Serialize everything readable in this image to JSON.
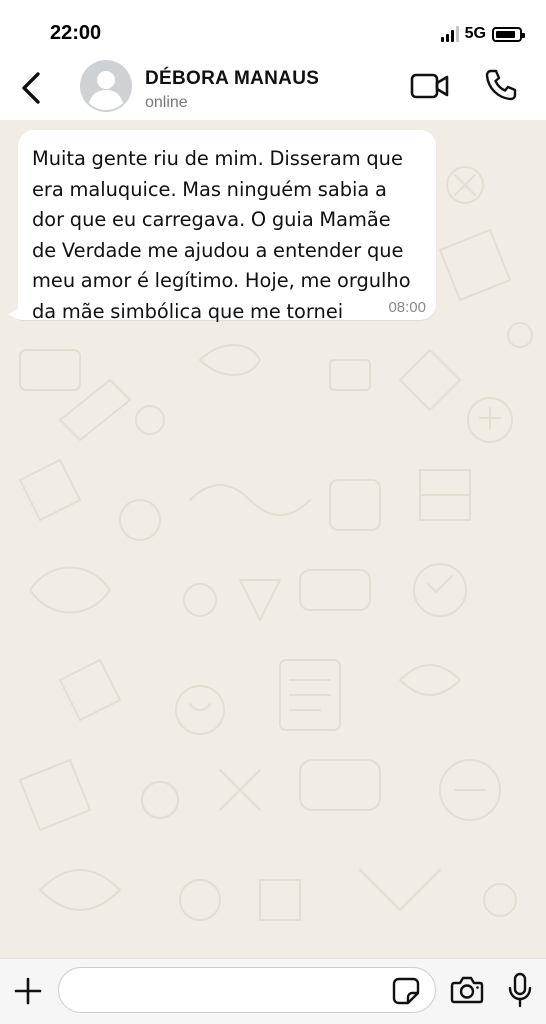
{
  "status_bar": {
    "time": "22:00",
    "network": "5G",
    "signal_bars_active": 3,
    "signal_bars_total": 4,
    "battery_level": 0.85
  },
  "header": {
    "back_icon": "chevron-left-icon",
    "contact_name": "DÉBORA MANAUS",
    "contact_status": "online",
    "video_icon": "video-camera-icon",
    "call_icon": "phone-icon"
  },
  "chat": {
    "wallpaper_color": "#f2ede4",
    "messages": [
      {
        "direction": "incoming",
        "text": "Muita gente riu de mim. Disseram que\nera maluquice. Mas ninguém sabia a\ndor que eu carregava. O guia Mamãe\nde Verdade me ajudou a entender que\nmeu amor é legítimo. Hoje, me orgulho\nda mãe simbólica que me tornei",
        "time": "08:00"
      }
    ]
  },
  "input_bar": {
    "plus_icon": "plus-icon",
    "message_value": "",
    "message_placeholder": "",
    "sticker_icon": "sticker-icon",
    "camera_icon": "camera-icon",
    "mic_icon": "microphone-icon"
  }
}
